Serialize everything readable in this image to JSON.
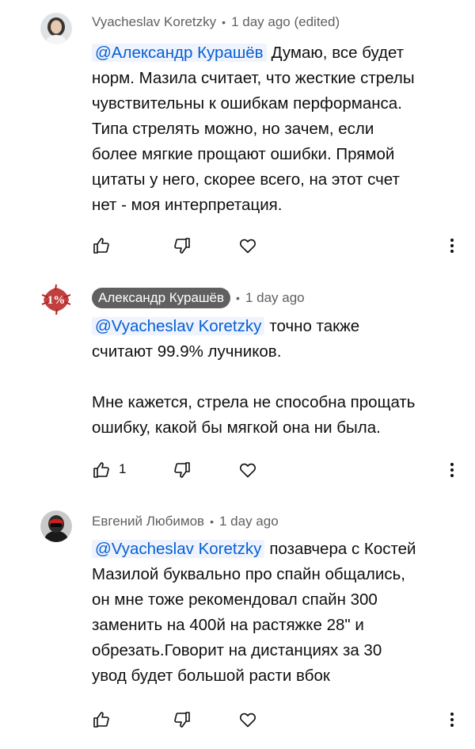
{
  "comments": [
    {
      "author": "Vyacheslav Koretzky",
      "separator": "•",
      "time": "1 day ago (edited)",
      "mention": "@Александр Курашёв",
      "lines": [
        "Думаю, все будет",
        "норм. Мазила считает, что жесткие стрелы",
        "чувствительны к ошибкам перформанса.",
        "Типа стрелять можно, но зачем, если",
        "более мягкие прощают ошибки. Прямой",
        "цитаты у него, скорее всего, на этот счет",
        "нет - моя интерпретация."
      ],
      "likes": ""
    },
    {
      "author": "Александр Курашёв",
      "author_is_creator": true,
      "separator": "•",
      "time": "1 day ago",
      "mention": "@Vyacheslav Koretzky",
      "lines": [
        "точно также",
        "считают 99.9% лучников."
      ],
      "lines2": [
        "Мне кажется, стрела не способна прощать",
        "ошибку, какой бы мягкой она ни была."
      ],
      "avatar_text": "1%",
      "likes": "1"
    },
    {
      "author": "Евгений Любимов",
      "separator": "•",
      "time": "1 day ago",
      "mention": "@Vyacheslav Koretzky",
      "lines": [
        "позавчера с Костей",
        "Мазилой буквально про спайн общались,",
        "он мне тоже рекомендовал спайн 300",
        "заменить на 400й на растяжке 28\" и",
        "обрезать.Говорит на дистанциях за 30",
        "увод будет большой расти вбок"
      ],
      "likes": ""
    }
  ],
  "icons": {
    "like": "thumbs-up-icon",
    "dislike": "thumbs-down-icon",
    "heart": "heart-icon",
    "more": "more-vert-icon"
  },
  "colors": {
    "mention": "#065fd4",
    "meta": "#606060",
    "creator_chip": "#606060"
  }
}
